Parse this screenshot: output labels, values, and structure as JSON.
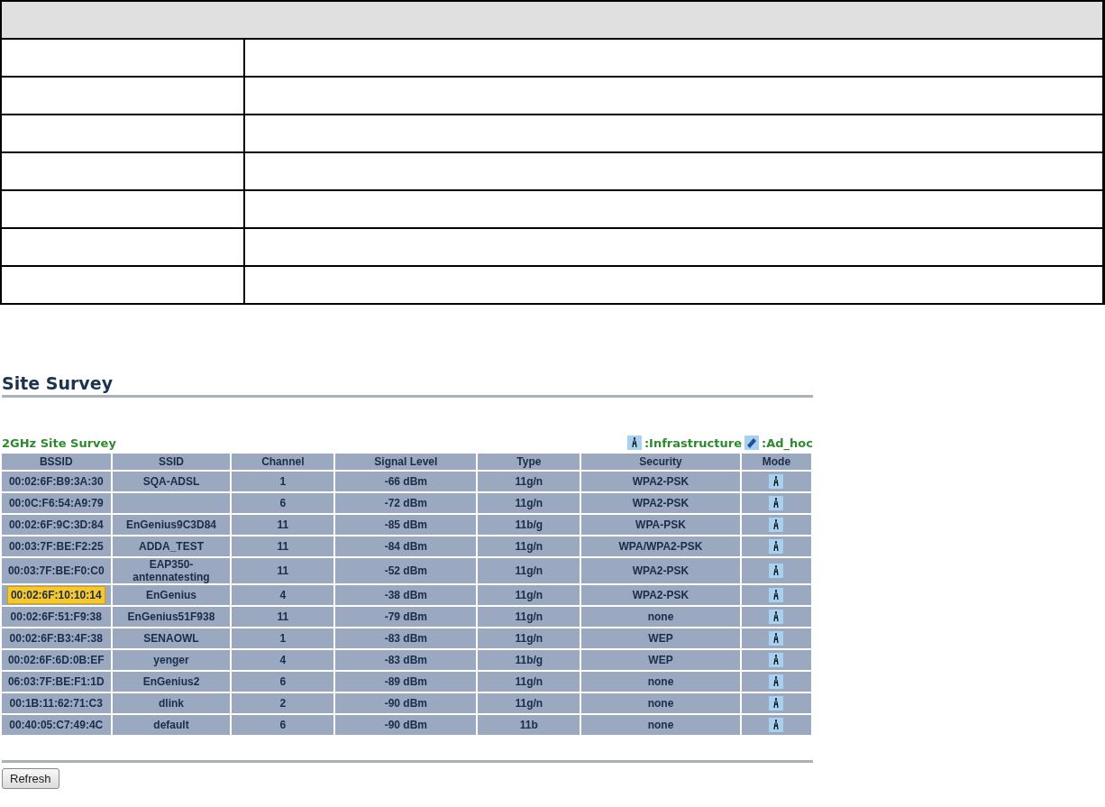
{
  "page_title": "Site Survey",
  "survey": {
    "title": "2GHz Site Survey",
    "legend": [
      {
        "kind": "infrastructure",
        "label": ":Infrastructure"
      },
      {
        "kind": "ad_hoc",
        "label": ":Ad_hoc"
      }
    ],
    "columns": [
      "BSSID",
      "SSID",
      "Channel",
      "Signal Level",
      "Type",
      "Security",
      "Mode"
    ],
    "rows": [
      {
        "bssid": "00:02:6F:B9:3A:30",
        "ssid": "SQA-ADSL",
        "channel": "1",
        "signal": "-66 dBm",
        "type": "11g/n",
        "security": "WPA2-PSK",
        "kind": "infrastructure",
        "highlighted": false
      },
      {
        "bssid": "00:0C:F6:54:A9:79",
        "channel": "6",
        "signal": "-72 dBm",
        "type": "11g/n",
        "security": "WPA2-PSK",
        "kind": "infrastructure",
        "highlighted": false
      },
      {
        "bssid": "00:02:6F:9C:3D:84",
        "ssid": "EnGenius9C3D84",
        "channel": "11",
        "signal": "-85 dBm",
        "type": "11b/g",
        "security": "WPA-PSK",
        "kind": "infrastructure",
        "highlighted": false
      },
      {
        "bssid": "00:03:7F:BE:F2:25",
        "ssid": "ADDA_TEST",
        "channel": "11",
        "signal": "-84 dBm",
        "type": "11g/n",
        "security": "WPA/WPA2-PSK",
        "kind": "infrastructure",
        "highlighted": false
      },
      {
        "bssid": "00:03:7F:BE:F0:C0",
        "ssid": "EAP350-antennatesting",
        "channel": "11",
        "signal": "-52 dBm",
        "type": "11g/n",
        "security": "WPA2-PSK",
        "kind": "infrastructure",
        "highlighted": false
      },
      {
        "bssid": "00:02:6F:10:10:14",
        "ssid": "EnGenius",
        "channel": "4",
        "signal": "-38 dBm",
        "type": "11g/n",
        "security": "WPA2-PSK",
        "kind": "infrastructure",
        "highlighted": true
      },
      {
        "bssid": "00:02:6F:51:F9:38",
        "ssid": "EnGenius51F938",
        "channel": "11",
        "signal": "-79 dBm",
        "type": "11g/n",
        "security": "none",
        "kind": "infrastructure",
        "highlighted": false
      },
      {
        "bssid": "00:02:6F:B3:4F:38",
        "ssid": "SENAOWL",
        "channel": "1",
        "signal": "-83 dBm",
        "type": "11g/n",
        "security": "WEP",
        "kind": "infrastructure",
        "highlighted": false
      },
      {
        "bssid": "00:02:6F:6D:0B:EF",
        "ssid": "yenger",
        "channel": "4",
        "signal": "-83 dBm",
        "type": "11b/g",
        "security": "WEP",
        "kind": "infrastructure",
        "highlighted": false
      },
      {
        "bssid": "06:03:7F:BE:F1:1D",
        "ssid": "EnGenius2",
        "channel": "6",
        "signal": "-89 dBm",
        "type": "11g/n",
        "security": "none",
        "kind": "infrastructure",
        "highlighted": false
      },
      {
        "bssid": "00:1B:11:62:71:C3",
        "ssid": "dlink",
        "channel": "2",
        "signal": "-90 dBm",
        "type": "11g/n",
        "security": "none",
        "kind": "infrastructure",
        "highlighted": false
      },
      {
        "bssid": "00:40:05:C7:49:4C",
        "ssid": "default",
        "channel": "6",
        "signal": "-90 dBm",
        "type": "11b",
        "security": "none",
        "kind": "infrastructure",
        "highlighted": false
      }
    ]
  },
  "refresh_button": "Refresh"
}
